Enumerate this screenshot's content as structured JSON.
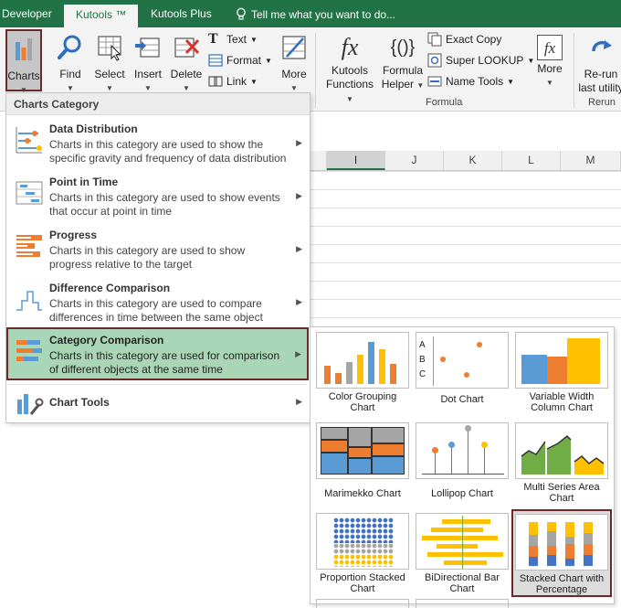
{
  "tabs": {
    "developer": "Developer",
    "kutools": "Kutools ™",
    "kutools_plus": "Kutools Plus",
    "tell_me": "Tell me what you want to do..."
  },
  "ribbon": {
    "charts": "Charts",
    "find": "Find",
    "select": "Select",
    "insert": "Insert",
    "delete": "Delete",
    "text": "Text",
    "format": "Format",
    "link": "Link",
    "more": "More",
    "kutools_functions_1": "Kutools",
    "kutools_functions_2": "Functions",
    "formula_helper_1": "Formula",
    "formula_helper_2": "Helper",
    "exact_copy": "Exact Copy",
    "super_lookup": "Super LOOKUP",
    "name_tools": "Name Tools",
    "more2": "More",
    "rerun_1": "Re-run",
    "rerun_2": "last utility",
    "group_formula": "Formula",
    "group_rerun": "Rerun",
    "icons": [
      "charts-icon",
      "find-icon",
      "select-icon",
      "insert-icon",
      "delete-icon",
      "fx-icon",
      "formula-helper-icon",
      "rerun-icon"
    ]
  },
  "columns": [
    "I",
    "J",
    "K",
    "L",
    "M"
  ],
  "menu": {
    "header": "Charts Category",
    "items": [
      {
        "title": "Data Distribution",
        "desc": "Charts in this category are used to show the specific gravity and frequency of data distribution"
      },
      {
        "title": "Point in Time",
        "desc": "Charts in this category are used to show events that occur at point in time"
      },
      {
        "title": "Progress",
        "desc": "Charts in this category are used to show progress relative to the target"
      },
      {
        "title": "Difference Comparison",
        "desc": "Charts in this category are used to compare differences in time between the same object"
      },
      {
        "title": "Category Comparison",
        "desc": "Charts in this category are used for comparison of different objects at the same time"
      },
      {
        "title": "Chart Tools",
        "desc": ""
      }
    ]
  },
  "submenu": {
    "cards": [
      {
        "label": "Color Grouping Chart"
      },
      {
        "label": "Dot Chart"
      },
      {
        "label": "Variable Width Column Chart"
      },
      {
        "label": "Marimekko Chart"
      },
      {
        "label": "Lollipop Chart"
      },
      {
        "label": "Multi Series Area Chart"
      },
      {
        "label": "Proportion Stacked Chart"
      },
      {
        "label": "BiDirectional Bar Chart"
      },
      {
        "label": "Stacked Chart with Percentage"
      }
    ],
    "dot_chart_letters": [
      "A",
      "B",
      "C"
    ]
  },
  "colors": {
    "excel_green": "#217346",
    "highlight_green": "#a9d6b6",
    "active_border": "#6b2a2a",
    "orange": "#ed7d31",
    "blue": "#5b9bd5",
    "gold": "#ffc000",
    "gray": "#a5a5a5",
    "green": "#70ad47"
  }
}
